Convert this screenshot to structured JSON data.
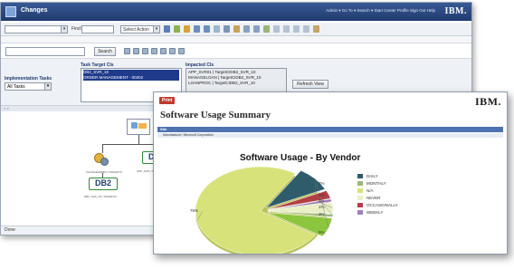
{
  "back_window": {
    "title": "Changes",
    "top_links": "Admin ▾  Go To ▾  Search ▾  Start Center  Profile  Sign Out  Help",
    "logo": "IBM.",
    "toolbar": {
      "find_label": "Find:",
      "action_select": "Select Action"
    },
    "search": {
      "button_label": "Search",
      "value": ""
    },
    "impl_tasks_label": "Implementation Tasks",
    "impl_tasks_value": "All Tasks",
    "task_target_label": "Task Target CIs",
    "task_targets": [
      "DB2_SVR_10",
      "ORDER MANAGEMENT - 00202"
    ],
    "impacted_label": "Impacted CIs",
    "impacted": [
      "APP_SVR01 | TargetCIDB2_SVR_10",
      "MANAGELOAN | TargetCIDB2_SVR_10",
      "LOANPROC | TargetCIDB2_SVR_10"
    ],
    "refresh_label": "Refresh View",
    "splitter": "< >",
    "status": "Done",
    "diagram": {
      "db2_label": "DB2"
    }
  },
  "front_window": {
    "badge": "Print",
    "logo": "IBM.",
    "report_title": "Software Usage Summary",
    "section": "Site",
    "manufacturer": "Manufacturer:  Microsoft Corporation"
  },
  "chart_data": {
    "type": "pie",
    "title": "Software Usage - By Vendor",
    "slices": [
      {
        "label": "N/A",
        "value": 75,
        "display": "75%",
        "color": "#d8e27a"
      },
      {
        "label": "DAILY",
        "value": 9,
        "display": "9%",
        "color": "#2e5c6b"
      },
      {
        "label": "OCCASIONALLY",
        "value": 3,
        "display": "3%",
        "color": "#b23f45"
      },
      {
        "label": "WEEKLY",
        "value": 1,
        "display": "1%",
        "color": "#9f7fc2"
      },
      {
        "label": "NEVER",
        "value": 4,
        "display": "4%",
        "color": "#e9f0c5"
      },
      {
        "label": "MONTHLY",
        "value": 1,
        "display": "1%",
        "color": "#9ab878"
      },
      {
        "label": "N/A2",
        "value": 7,
        "display": "7%",
        "color": "#8cc63e"
      }
    ],
    "legend": [
      {
        "label": "DAILY",
        "color": "#2e5c6b"
      },
      {
        "label": "MONTHLY",
        "color": "#9ab878"
      },
      {
        "label": "N/A",
        "color": "#d8e27a"
      },
      {
        "label": "NEVER",
        "color": "#e9f0c5"
      },
      {
        "label": "OCCASIONALLY",
        "color": "#b23f45"
      },
      {
        "label": "WEEKLY",
        "color": "#9f7fc2"
      }
    ],
    "legend_position": "right"
  }
}
